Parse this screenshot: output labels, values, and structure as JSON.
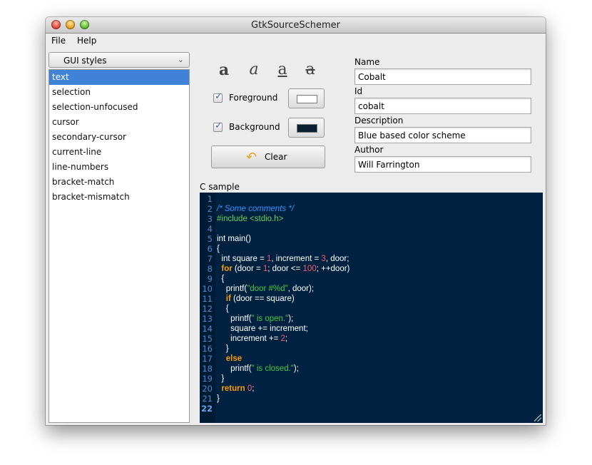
{
  "window": {
    "title": "GtkSourceSchemer"
  },
  "menu": {
    "items": [
      "File",
      "Help"
    ]
  },
  "styles_combo": {
    "value": "GUI styles"
  },
  "style_list": [
    "text",
    "selection",
    "selection-unfocused",
    "cursor",
    "secondary-cursor",
    "current-line",
    "line-numbers",
    "bracket-match",
    "bracket-mismatch"
  ],
  "selected_style": "text",
  "text_style_icons": [
    "bold-icon",
    "italic-icon",
    "underline-icon",
    "strikethrough-icon"
  ],
  "foreground": {
    "label": "Foreground",
    "checked": true,
    "color": "#ffffff"
  },
  "background": {
    "label": "Background",
    "checked": true,
    "color": "#0b1f33"
  },
  "clear_button": {
    "label": "Clear",
    "icon": "undo-arrow-icon"
  },
  "fields": {
    "name_label": "Name",
    "name_value": "Cobalt",
    "id_label": "Id",
    "id_value": "cobalt",
    "description_label": "Description",
    "description_value": "Blue based color scheme",
    "author_label": "Author",
    "author_value": "Will Farrington"
  },
  "sample": {
    "label": "C sample"
  },
  "code_lines": [
    [],
    [
      [
        "c-comment",
        "/* Some comments */"
      ]
    ],
    [
      [
        "c-prep",
        "#include <stdio.h>"
      ]
    ],
    [],
    [
      [
        "",
        "int main()"
      ]
    ],
    [
      [
        "",
        "{"
      ]
    ],
    [
      [
        "",
        "  int square = "
      ],
      [
        "c-num",
        "1"
      ],
      [
        "",
        ", increment = "
      ],
      [
        "c-num",
        "3"
      ],
      [
        "",
        ", door;"
      ]
    ],
    [
      [
        "c-keyword",
        "  for"
      ],
      [
        "",
        " (door = "
      ],
      [
        "c-num",
        "1"
      ],
      [
        "",
        "; door <= "
      ],
      [
        "c-num",
        "100"
      ],
      [
        "",
        "; ++door)"
      ]
    ],
    [
      [
        "",
        "  {"
      ]
    ],
    [
      [
        "",
        "    printf("
      ],
      [
        "c-str",
        "\"door #%d\""
      ],
      [
        "",
        ", door);"
      ]
    ],
    [
      [
        "c-keyword",
        "    if"
      ],
      [
        "",
        " (door == square)"
      ]
    ],
    [
      [
        "",
        "    {"
      ]
    ],
    [
      [
        "",
        "      printf("
      ],
      [
        "c-str",
        "\" is open.\""
      ],
      [
        "",
        ");"
      ]
    ],
    [
      [
        "",
        "      square += increment;"
      ]
    ],
    [
      [
        "",
        "      increment += "
      ],
      [
        "c-num",
        "2"
      ],
      [
        "",
        ";"
      ]
    ],
    [
      [
        "",
        "    }"
      ]
    ],
    [
      [
        "c-keyword",
        "    else"
      ]
    ],
    [
      [
        "",
        "      printf("
      ],
      [
        "c-str",
        "\" is closed.\""
      ],
      [
        "",
        ");"
      ]
    ],
    [
      [
        "",
        "  }"
      ]
    ],
    [
      [
        "c-keyword",
        "  return"
      ],
      [
        "",
        " "
      ],
      [
        "c-num",
        "0"
      ],
      [
        "",
        ";"
      ]
    ],
    [
      [
        "",
        "}"
      ]
    ],
    []
  ]
}
